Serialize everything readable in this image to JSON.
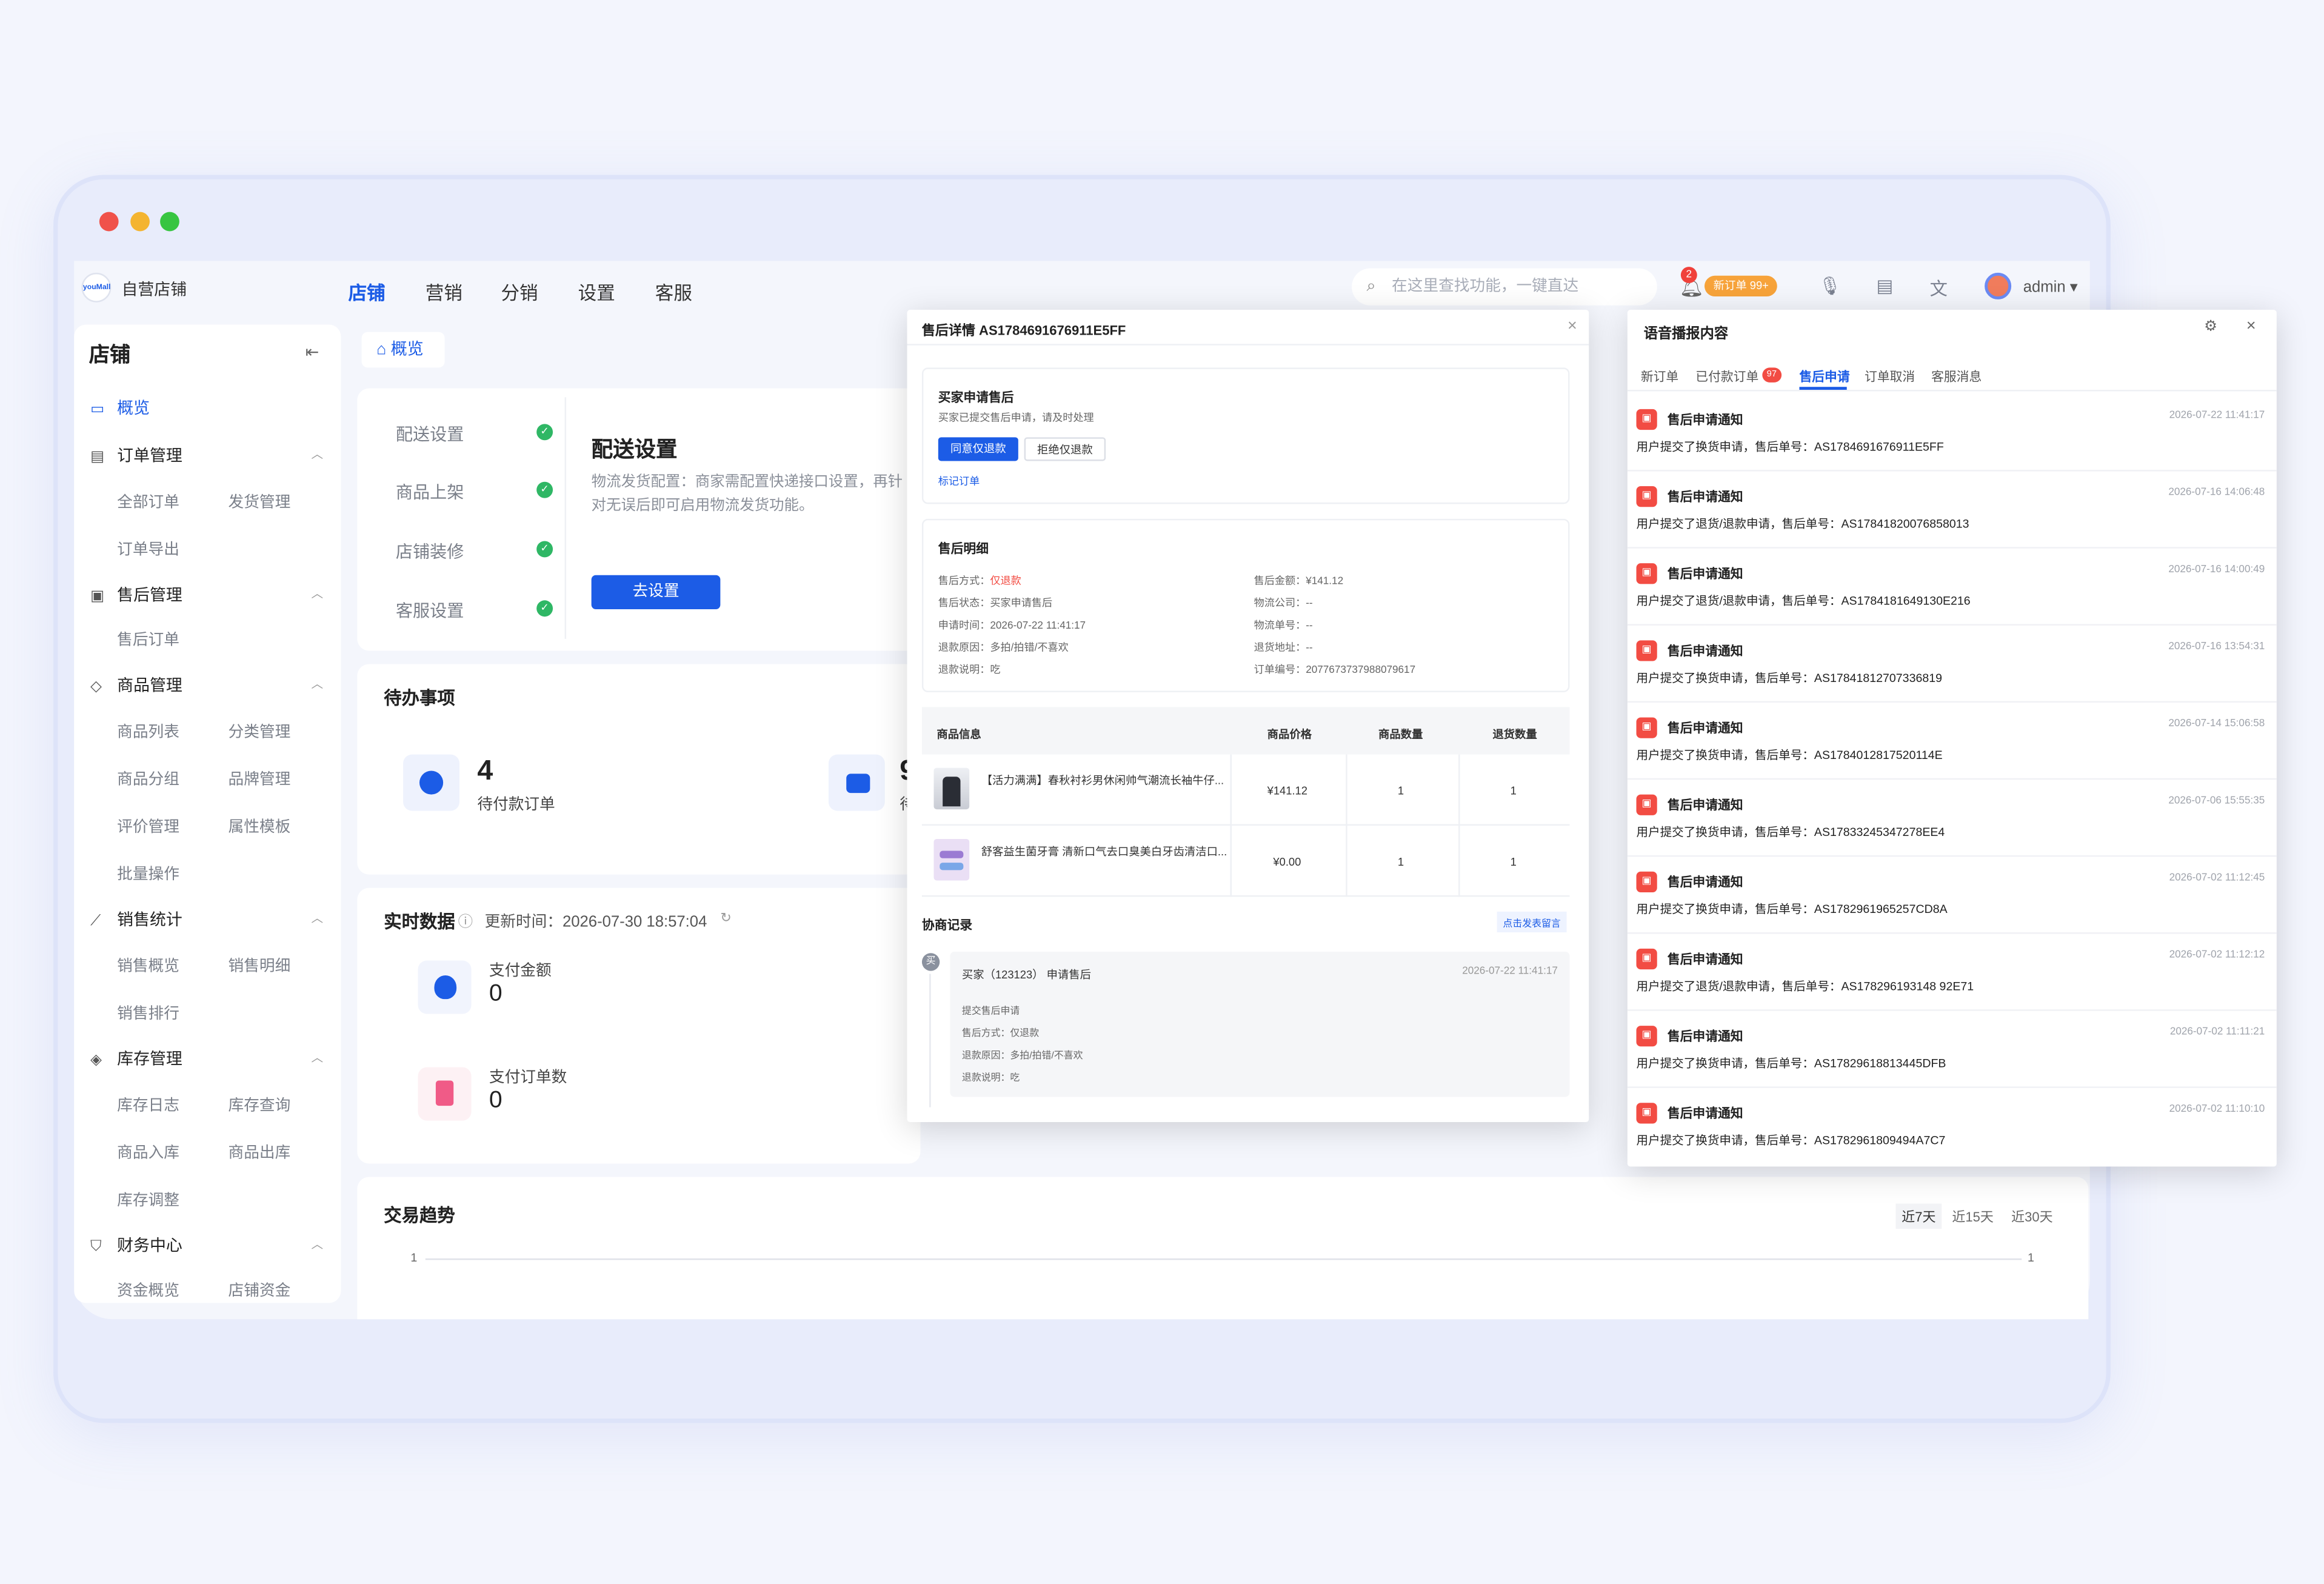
{
  "app": {
    "shop_name": "自营店铺",
    "logo_text": "youMall",
    "admin": "admin ▾"
  },
  "nav": [
    "店铺",
    "营销",
    "分销",
    "设置",
    "客服"
  ],
  "search": {
    "placeholder": "在这里查找功能，一键直达"
  },
  "header": {
    "bell_count": "2",
    "new_order_badge": "新订单 99+"
  },
  "sidebar": {
    "title": "店铺",
    "active": "概览",
    "groups": [
      {
        "label": "订单管理",
        "items": [
          "全部订单",
          "发货管理",
          "订单导出"
        ]
      },
      {
        "label": "售后管理",
        "items": [
          "售后订单"
        ]
      },
      {
        "label": "商品管理",
        "items": [
          "商品列表",
          "分类管理",
          "商品分组",
          "品牌管理",
          "评价管理",
          "属性模板",
          "批量操作"
        ]
      },
      {
        "label": "销售统计",
        "items": [
          "销售概览",
          "销售明细",
          "销售排行"
        ]
      },
      {
        "label": "库存管理",
        "items": [
          "库存日志",
          "库存查询",
          "商品入库",
          "商品出库",
          "库存调整"
        ]
      },
      {
        "label": "财务中心",
        "items": [
          "资金概览",
          "店铺资金"
        ]
      }
    ]
  },
  "main": {
    "tab_home": "概览",
    "setup_steps": [
      "配送设置",
      "商品上架",
      "店铺装修",
      "客服设置"
    ],
    "setup_title": "配送设置",
    "setup_desc": "物流发货配置：商家需配置快递接口设置，再针对无误后即可启用物流发货功能。",
    "setup_button": "去设置",
    "todo_title": "待办事项",
    "todo_count": "4",
    "todo_label": "待付款订单",
    "todo_count2": "9",
    "todo_label2": "待",
    "realtime_title": "实时数据",
    "update_time": "更新时间：2026-07-30 18:57:04",
    "pay_amount_label": "支付金额",
    "pay_amount": "0",
    "pay_orders_label": "支付订单数",
    "pay_orders": "0",
    "trend_title": "交易趋势",
    "trend_ranges": [
      "近7天",
      "近15天",
      "近30天"
    ],
    "trend_axis_left": "1",
    "trend_axis_right": "1"
  },
  "modal": {
    "title": "售后详情 AS1784691676911E5FF",
    "apply_title": "买家申请售后",
    "apply_desc": "买家已提交售后申请，请及时处理",
    "agree_btn": "同意仅退款",
    "reject_btn": "拒绝仅退款",
    "mark_link": "标记订单",
    "detail_title": "售后明细",
    "left_fields": [
      {
        "k": "售后方式：",
        "v": "仅退款",
        "red": true
      },
      {
        "k": "售后状态：",
        "v": "买家申请售后"
      },
      {
        "k": "申请时间：",
        "v": "2026-07-22 11:41:17"
      },
      {
        "k": "退款原因：",
        "v": "多拍/拍错/不喜欢"
      },
      {
        "k": "退款说明：",
        "v": "吃"
      }
    ],
    "right_fields": [
      {
        "k": "售后金额：",
        "v": "¥141.12"
      },
      {
        "k": "物流公司：",
        "v": "--"
      },
      {
        "k": "物流单号：",
        "v": "--"
      },
      {
        "k": "退货地址：",
        "v": "--"
      },
      {
        "k": "订单编号：",
        "v": "2077673737988079617"
      }
    ],
    "table_headers": [
      "商品信息",
      "商品价格",
      "商品数量",
      "退货数量"
    ],
    "rows": [
      {
        "name": "【活力满满】春秋衬衫男休闲帅气潮流长袖牛仔...",
        "price": "¥141.12",
        "qty": "1",
        "ret": "1"
      },
      {
        "name": "舒客益生菌牙膏 清新口气去口臭美白牙齿清洁口...",
        "price": "¥0.00",
        "qty": "1",
        "ret": "1"
      }
    ],
    "nego_title": "协商记录",
    "nego_link": "点击发表留言",
    "nego_avatar": "买",
    "nego_who": "买家（123123） 申请售后",
    "nego_time": "2026-07-22 11:41:17",
    "nego_lines": [
      "提交售后申请",
      "售后方式：仅退款",
      "退款原因：多拍/拍错/不喜欢",
      "退款说明：吃"
    ]
  },
  "voice": {
    "title": "语音播报内容",
    "tabs": [
      "新订单",
      "已付款订单",
      "售后申请",
      "订单取消",
      "客服消息"
    ],
    "paid_badge": "97",
    "active_tab": "售后申请",
    "items": [
      {
        "name": "售后申请通知",
        "time": "2026-07-22 11:41:17",
        "msg": "用户提交了换货申请，售后单号：AS1784691676911E5FF"
      },
      {
        "name": "售后申请通知",
        "time": "2026-07-16 14:06:48",
        "msg": "用户提交了退货/退款申请，售后单号：AS17841820076858013"
      },
      {
        "name": "售后申请通知",
        "time": "2026-07-16 14:00:49",
        "msg": "用户提交了退货/退款申请，售后单号：AS1784181649130E216"
      },
      {
        "name": "售后申请通知",
        "time": "2026-07-16 13:54:31",
        "msg": "用户提交了换货申请，售后单号：AS17841812707336819"
      },
      {
        "name": "售后申请通知",
        "time": "2026-07-14 15:06:58",
        "msg": "用户提交了换货申请，售后单号：AS1784012817520114E"
      },
      {
        "name": "售后申请通知",
        "time": "2026-07-06 15:55:35",
        "msg": "用户提交了换货申请，售后单号：AS17833245347278EE4"
      },
      {
        "name": "售后申请通知",
        "time": "2026-07-02 11:12:45",
        "msg": "用户提交了换货申请，售后单号：AS1782961965257CD8A"
      },
      {
        "name": "售后申请通知",
        "time": "2026-07-02 11:12:12",
        "msg": "用户提交了退货/退款申请，售后单号：AS178296193148 92E71"
      },
      {
        "name": "售后申请通知",
        "time": "2026-07-02 11:11:21",
        "msg": "用户提交了换货申请，售后单号：AS17829618813445DFB"
      },
      {
        "name": "售后申请通知",
        "time": "2026-07-02 11:10:10",
        "msg": "用户提交了换货申请，售后单号：AS1782961809494A7C7"
      }
    ]
  },
  "colors": {
    "primary": "#1c5ce6",
    "success": "#2fb765",
    "danger": "#f24c43",
    "warning": "#f7a33a"
  }
}
